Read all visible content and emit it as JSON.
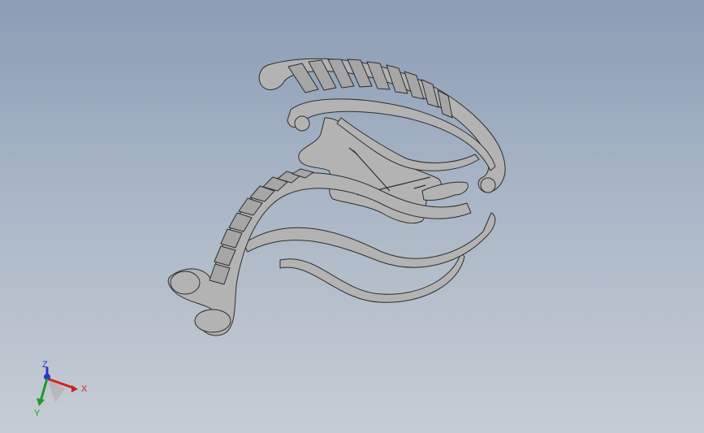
{
  "viewport": {
    "background_top": "#8a9db5",
    "background_bottom": "#c6ccd4",
    "model_color": "#b3b3b3",
    "edge_color": "#2e2e2e"
  },
  "triad": {
    "x_label": "X",
    "y_label": "Y",
    "z_label": "Z",
    "x_color": "#d42020",
    "y_color": "#1f9a2a",
    "z_color": "#2636c8"
  }
}
